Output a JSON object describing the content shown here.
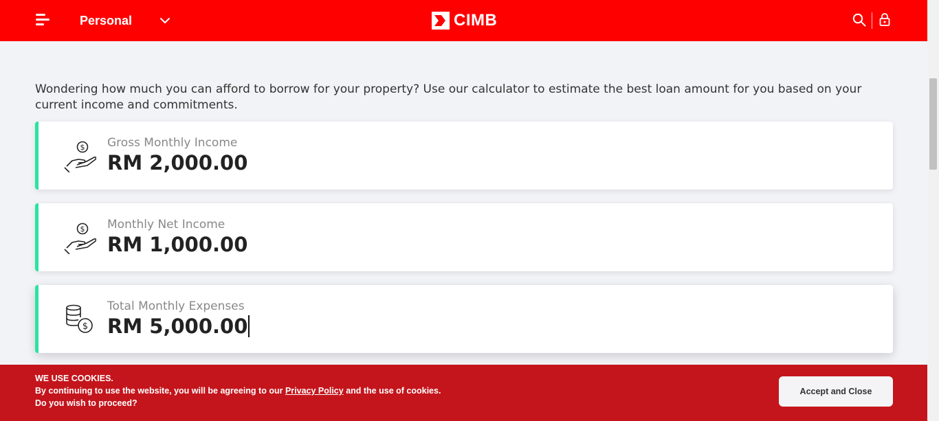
{
  "header": {
    "segment": "Personal",
    "brand": "CIMB"
  },
  "intro": "Wondering how much you can afford to borrow for your property? Use our calculator to estimate the best loan amount for you based on your current income and commitments.",
  "fields": [
    {
      "label": "Gross Monthly Income",
      "value": "RM 2,000.00",
      "icon": "hand-coin-icon"
    },
    {
      "label": "Monthly Net Income",
      "value": "RM 1,000.00",
      "icon": "hand-coin-icon"
    },
    {
      "label": "Total Monthly Expenses",
      "value": "RM 5,000.00",
      "icon": "coin-stack-icon"
    }
  ],
  "cookie": {
    "title": "WE USE COOKIES.",
    "text_before": "By continuing to use the website, you will be agreeing to our ",
    "link": "Privacy Policy",
    "text_after": " and the use of cookies.",
    "question": "Do you wish to proceed?",
    "accept_label": "Accept and Close"
  },
  "colors": {
    "header_bg": "#ff0000",
    "accent_green": "#2be3a0",
    "cookie_bg": "#c4151c"
  }
}
